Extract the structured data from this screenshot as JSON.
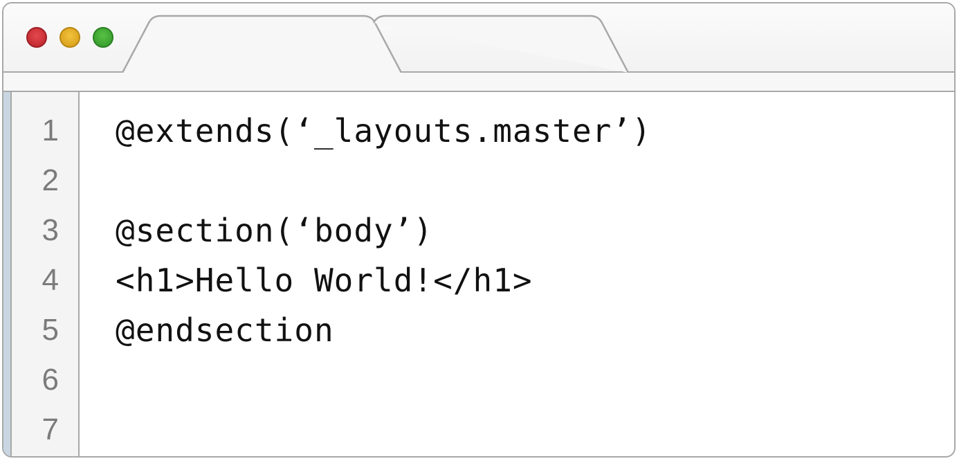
{
  "window": {
    "traffic_lights": [
      {
        "name": "close",
        "color": "#d83a40"
      },
      {
        "name": "minimize",
        "color": "#e6b12a"
      },
      {
        "name": "zoom",
        "color": "#46aa36"
      }
    ],
    "tabs": [
      {
        "label": ""
      },
      {
        "label": ""
      }
    ]
  },
  "editor": {
    "line_numbers": [
      "1",
      "2",
      "3",
      "4",
      "5",
      "6",
      "7"
    ],
    "lines": [
      "@extends(‘_layouts.master’)",
      "",
      "@section(‘body’)",
      "<h1>Hello World!</h1>",
      "@endsection",
      "",
      ""
    ]
  }
}
